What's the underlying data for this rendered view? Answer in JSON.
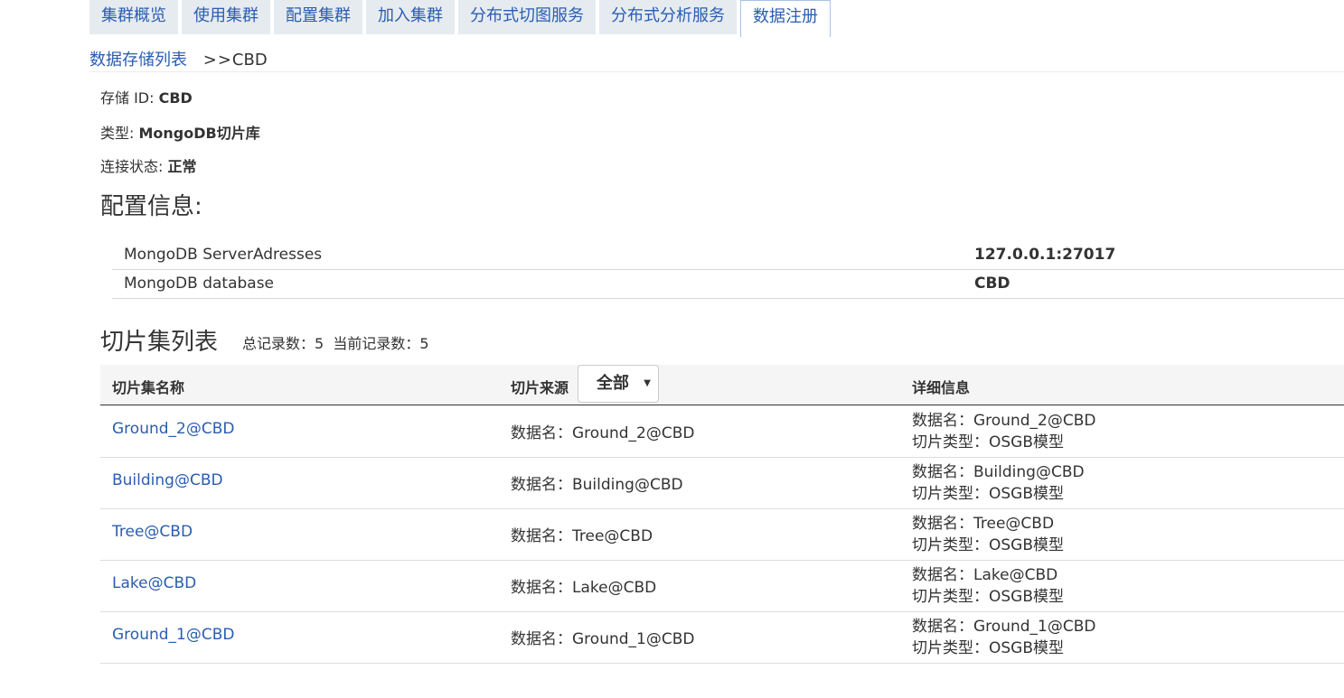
{
  "tabs": [
    "集群概览",
    "使用集群",
    "配置集群",
    "加入集群",
    "分布式切图服务",
    "分布式分析服务",
    "数据注册"
  ],
  "active_tab": "数据注册",
  "breadcrumb": {
    "link": "数据存储列表",
    "sep": ">>",
    "current": "CBD"
  },
  "storage": {
    "id_label": "存储 ID: ",
    "id_value": "CBD",
    "type_label": "类型: ",
    "type_value": "MongoDB切片库",
    "status_label": "连接状态: ",
    "status_value": "正常"
  },
  "config": {
    "heading": "配置信息:",
    "rows": [
      {
        "key": "MongoDB ServerAdresses",
        "value": "127.0.0.1:27017"
      },
      {
        "key": "MongoDB database",
        "value": "CBD"
      }
    ]
  },
  "tiles": {
    "heading": "切片集列表",
    "counts": "总记录数：5  当前记录数：5",
    "columns": {
      "name": "切片集名称",
      "source": "切片来源",
      "detail": "详细信息"
    },
    "filter": {
      "selected": "全部",
      "caret": "▼"
    },
    "rows": [
      {
        "name": "Ground_2@CBD",
        "source": "数据名：Ground_2@CBD",
        "detail1": "数据名：Ground_2@CBD",
        "detail2": "切片类型：OSGB模型"
      },
      {
        "name": "Building@CBD",
        "source": "数据名：Building@CBD",
        "detail1": "数据名：Building@CBD",
        "detail2": "切片类型：OSGB模型"
      },
      {
        "name": "Tree@CBD",
        "source": "数据名：Tree@CBD",
        "detail1": "数据名：Tree@CBD",
        "detail2": "切片类型：OSGB模型"
      },
      {
        "name": "Lake@CBD",
        "source": "数据名：Lake@CBD",
        "detail1": "数据名：Lake@CBD",
        "detail2": "切片类型：OSGB模型"
      },
      {
        "name": "Ground_1@CBD",
        "source": "数据名：Ground_1@CBD",
        "detail1": "数据名：Ground_1@CBD",
        "detail2": "切片类型：OSGB模型"
      }
    ]
  }
}
